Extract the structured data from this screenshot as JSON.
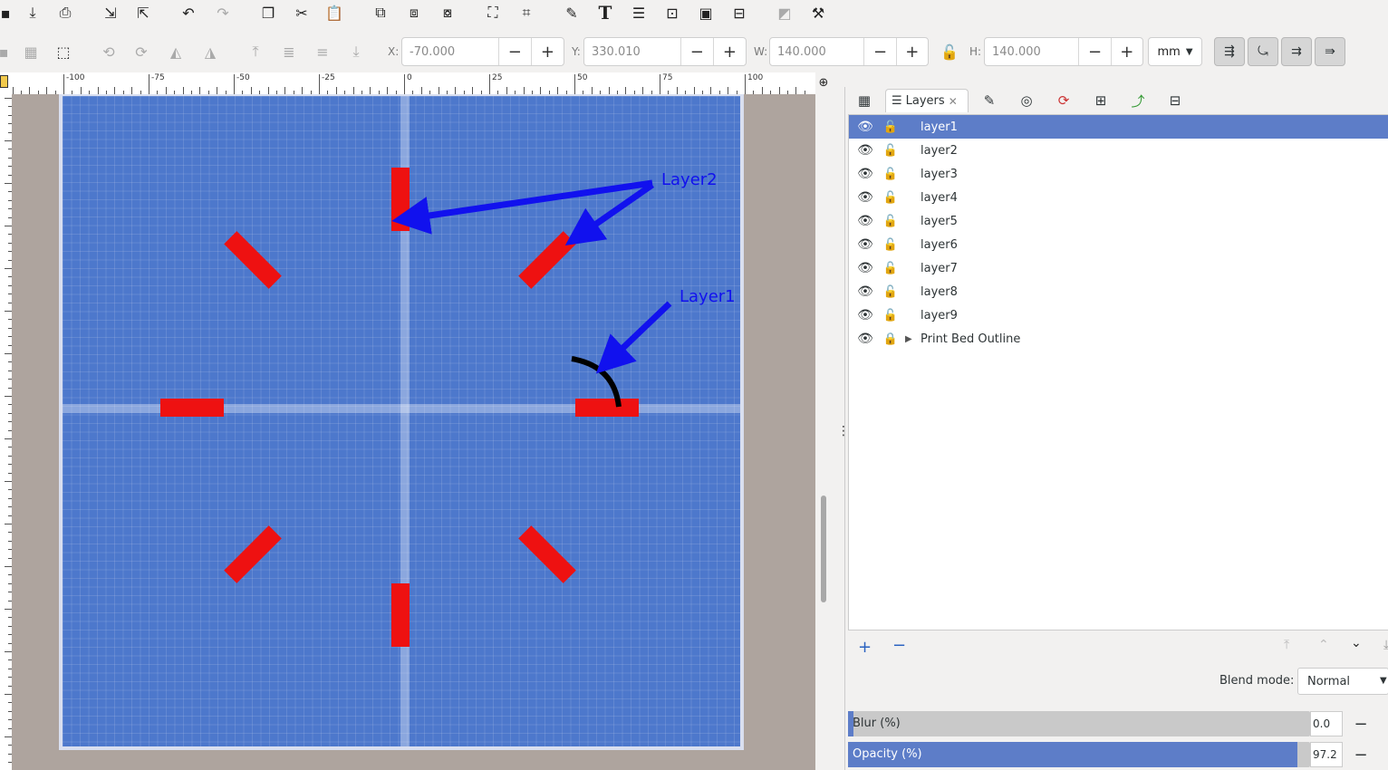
{
  "toolbar": {
    "icons": [
      "save-icon",
      "print-icon",
      "import-icon",
      "export-icon",
      "undo-icon",
      "redo-icon",
      "copy-icon",
      "cut-icon",
      "paste-icon",
      "duplicate-icon",
      "clone-icon",
      "unlink-clone-icon",
      "zoom-selection-icon",
      "zoom-drawing-icon",
      "edit-path-icon",
      "text-icon",
      "layers-icon",
      "xml-editor-icon",
      "fill-stroke-icon",
      "align-icon",
      "transform-icon",
      "preferences-icon"
    ]
  },
  "controls": {
    "x_label": "X:",
    "x_value": "-70.000",
    "y_label": "Y:",
    "y_value": "330.010",
    "w_label": "W:",
    "w_value": "140.000",
    "h_label": "H:",
    "h_value": "140.000",
    "unit": "mm",
    "minus": "−",
    "plus": "+"
  },
  "ruler": {
    "labels": [
      "-100",
      "-75",
      "-50",
      "-25",
      "0",
      "25",
      "50",
      "75",
      "100"
    ]
  },
  "canvas": {
    "annotation_layer2": "Layer2",
    "annotation_layer1": "Layer1",
    "colors": {
      "page": "#4d78cc",
      "shape": "#ee1111",
      "arrow": "#1111ee",
      "arc": "#000000"
    }
  },
  "panel": {
    "tab_label": "Layers",
    "layers": [
      {
        "name": "layer1",
        "locked": false,
        "selected": true
      },
      {
        "name": "layer2",
        "locked": false
      },
      {
        "name": "layer3",
        "locked": false
      },
      {
        "name": "layer4",
        "locked": false
      },
      {
        "name": "layer5",
        "locked": false
      },
      {
        "name": "layer6",
        "locked": false
      },
      {
        "name": "layer7",
        "locked": false
      },
      {
        "name": "layer8",
        "locked": false
      },
      {
        "name": "layer9",
        "locked": false
      },
      {
        "name": "Print Bed Outline",
        "locked": true,
        "expandable": true
      }
    ],
    "blend_label": "Blend mode:",
    "blend_value": "Normal",
    "blur_label": "Blur (%)",
    "blur_value": "0.0",
    "opacity_label": "Opacity (%)",
    "opacity_value": "97.2",
    "opacity_fraction": 0.972,
    "blur_fraction": 0.0
  }
}
